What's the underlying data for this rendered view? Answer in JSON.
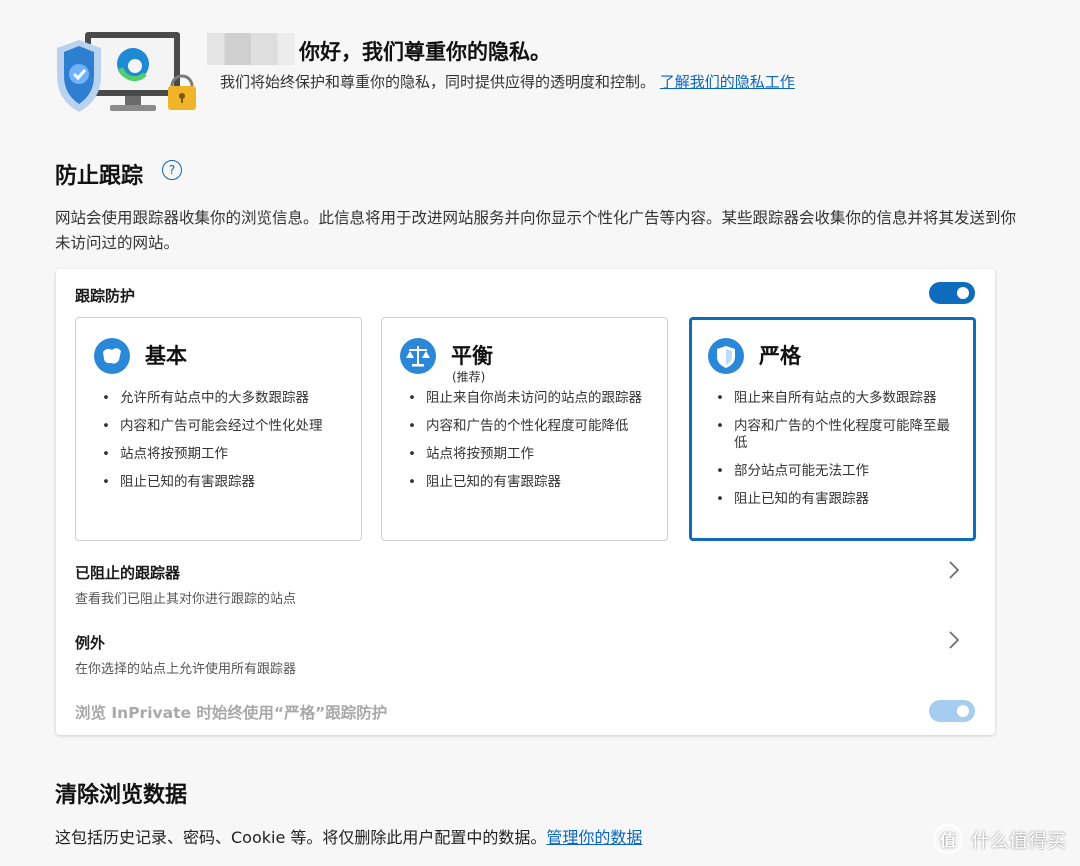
{
  "header": {
    "greeting": "你好，我们尊重你的隐私。",
    "subtitle": "我们将始终保护和尊重你的隐私，同时提供应得的透明度和控制。",
    "learn_more_link": "了解我们的隐私工作"
  },
  "tracking": {
    "heading": "防止跟踪",
    "help_icon": "?",
    "description": "网站会使用跟踪器收集你的浏览信息。此信息将用于改进网站服务并向你显示个性化广告等内容。某些跟踪器会收集你的信息并将其发送到你未访问过的网站。",
    "card_title": "跟踪防护",
    "enabled": true,
    "options": [
      {
        "title": "基本",
        "subtitle": "",
        "icon": "basic-icon",
        "selected": false,
        "bullets": [
          "允许所有站点中的大多数跟踪器",
          "内容和广告可能会经过个性化处理",
          "站点将按预期工作",
          "阻止已知的有害跟踪器"
        ]
      },
      {
        "title": "平衡",
        "subtitle": "(推荐)",
        "icon": "scales-icon",
        "selected": false,
        "bullets": [
          "阻止来自你尚未访问的站点的跟踪器",
          "内容和广告的个性化程度可能降低",
          "站点将按预期工作",
          "阻止已知的有害跟踪器"
        ]
      },
      {
        "title": "严格",
        "subtitle": "",
        "icon": "shield-icon",
        "selected": true,
        "bullets": [
          "阻止来自所有站点的大多数跟踪器",
          "内容和广告的个性化程度可能降至最低",
          "部分站点可能无法工作",
          "阻止已知的有害跟踪器"
        ]
      }
    ],
    "blocked": {
      "title": "已阻止的跟踪器",
      "subtitle": "查看我们已阻止其对你进行跟踪的站点"
    },
    "exceptions": {
      "title": "例外",
      "subtitle": "在你选择的站点上允许使用所有跟踪器"
    },
    "inprivate": {
      "label": "浏览 InPrivate 时始终使用“严格”跟踪防护",
      "enabled": true,
      "disabled": true
    }
  },
  "clear": {
    "heading": "清除浏览数据",
    "description": "这包括历史记录、密码、Cookie 等。将仅删除此用户配置中的数据。",
    "manage_link": "管理你的数据"
  },
  "watermark": {
    "text": "什么值得买",
    "badge": "值"
  },
  "colors": {
    "accent": "#0f6cbd",
    "link": "#0a66c2",
    "toggle_disabled": "#a6cdf0"
  }
}
